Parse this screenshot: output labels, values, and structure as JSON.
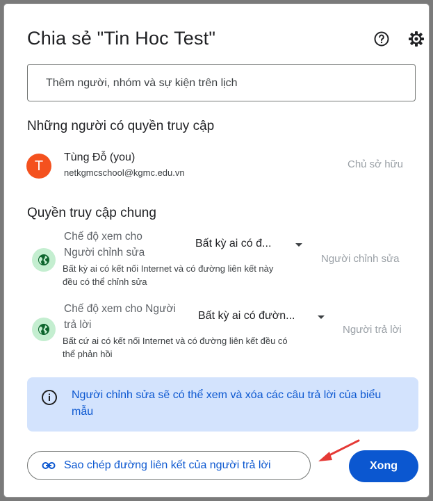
{
  "dialog": {
    "title": "Chia sẻ \"Tin Hoc Test\"",
    "icons": {
      "help": "help-circle-icon",
      "settings": "gear-icon"
    }
  },
  "search": {
    "placeholder": "Thêm người, nhóm và sự kiện trên lịch",
    "value": ""
  },
  "people": {
    "heading": "Những người có quyền truy cập",
    "users": [
      {
        "initial": "T",
        "name": "Tùng Đỗ (you)",
        "email": "netkgmcschool@kgmc.edu.vn",
        "role": "Chủ sở hữu",
        "avatar_color": "#f4511e"
      }
    ]
  },
  "general_access": {
    "heading": "Quyền truy cập chung",
    "rows": [
      {
        "mode_label_line1": "Chế độ xem cho",
        "mode_label_line2": "Người chỉnh sửa",
        "selected": "Bất kỳ ai có đ...",
        "description_line1": "Bất kỳ ai có kết nối Internet và có đường liên kết này",
        "description_line2": "đều có thể chỉnh sửa",
        "role": "Người chỉnh sửa"
      },
      {
        "mode_label_line1": "Chế độ xem cho Người",
        "mode_label_line2": "trả lời",
        "selected": "Bất kỳ ai có đườn...",
        "description_line1": "Bất cứ ai có kết nối Internet và có đường liên kết đều có",
        "description_line2": "thể phản hồi",
        "role": "Người trả lời"
      }
    ]
  },
  "info": {
    "text": "Người chỉnh sửa sẽ có thể xem và xóa các câu trả lời của biểu mẫu"
  },
  "footer": {
    "copy_link_label": "Sao chép đường liên kết của người trả lời",
    "done_label": "Xong"
  },
  "colors": {
    "accent": "#0b57d0",
    "info_bg": "#d3e3fd",
    "globe_bg": "#c4eed0",
    "annotation_arrow": "#e53935"
  }
}
